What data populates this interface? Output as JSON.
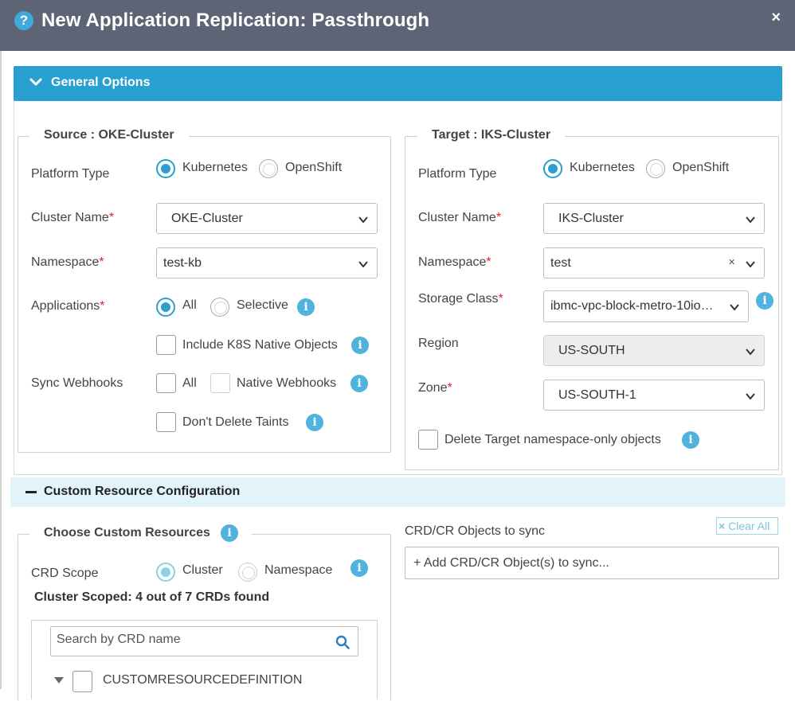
{
  "dialog": {
    "title": "New Application Replication: Passthrough",
    "help_glyph": "?",
    "close_glyph": "×"
  },
  "general": {
    "header": "General Options",
    "source": {
      "legend": "Source : OKE-Cluster",
      "platform_label": "Platform Type",
      "platform_options": [
        "Kubernetes",
        "OpenShift"
      ],
      "platform_selected": "Kubernetes",
      "cluster_label": "Cluster Name",
      "cluster_value": "OKE-Cluster",
      "namespace_label": "Namespace",
      "namespace_value": "test-kb",
      "applications_label": "Applications",
      "applications_options": [
        "All",
        "Selective"
      ],
      "applications_selected": "All",
      "include_k8s_label": "Include K8S Native Objects",
      "sync_webhooks_label": "Sync Webhooks",
      "webhook_all_label": "All",
      "webhook_native_label": "Native Webhooks",
      "dont_delete_taints_label": "Don't Delete Taints"
    },
    "target": {
      "legend": "Target : IKS-Cluster",
      "platform_label": "Platform Type",
      "platform_options": [
        "Kubernetes",
        "OpenShift"
      ],
      "platform_selected": "Kubernetes",
      "cluster_label": "Cluster Name",
      "cluster_value": "IKS-Cluster",
      "namespace_label": "Namespace",
      "namespace_value": "test",
      "storage_label": "Storage Class",
      "storage_value": "ibmc-vpc-block-metro-10io…",
      "region_label": "Region",
      "region_value": "US-SOUTH",
      "zone_label": "Zone",
      "zone_value": "US-SOUTH-1",
      "delete_target_label": "Delete Target namespace-only objects"
    },
    "required_mark": "*"
  },
  "custom_resources": {
    "header": "Custom Resource Configuration",
    "choose_legend": "Choose Custom Resources",
    "crd_scope_label": "CRD Scope",
    "crd_scope_options": [
      "Cluster",
      "Namespace"
    ],
    "crd_scope_selected": "Cluster",
    "found_text": "Cluster Scoped: 4 out of 7 CRDs found",
    "search_placeholder": "Search by CRD name",
    "tree_item": "CUSTOMRESOURCEDEFINITION",
    "sync_label": "CRD/CR Objects to sync",
    "clear_all": "Clear All",
    "clear_glyph": "×",
    "add_placeholder": "+ Add CRD/CR Object(s) to sync..."
  },
  "colors": {
    "titlebar": "#5d6475",
    "accent": "#2aa0d0",
    "required": "#d9262c",
    "section_bg": "#e3f3fa"
  }
}
